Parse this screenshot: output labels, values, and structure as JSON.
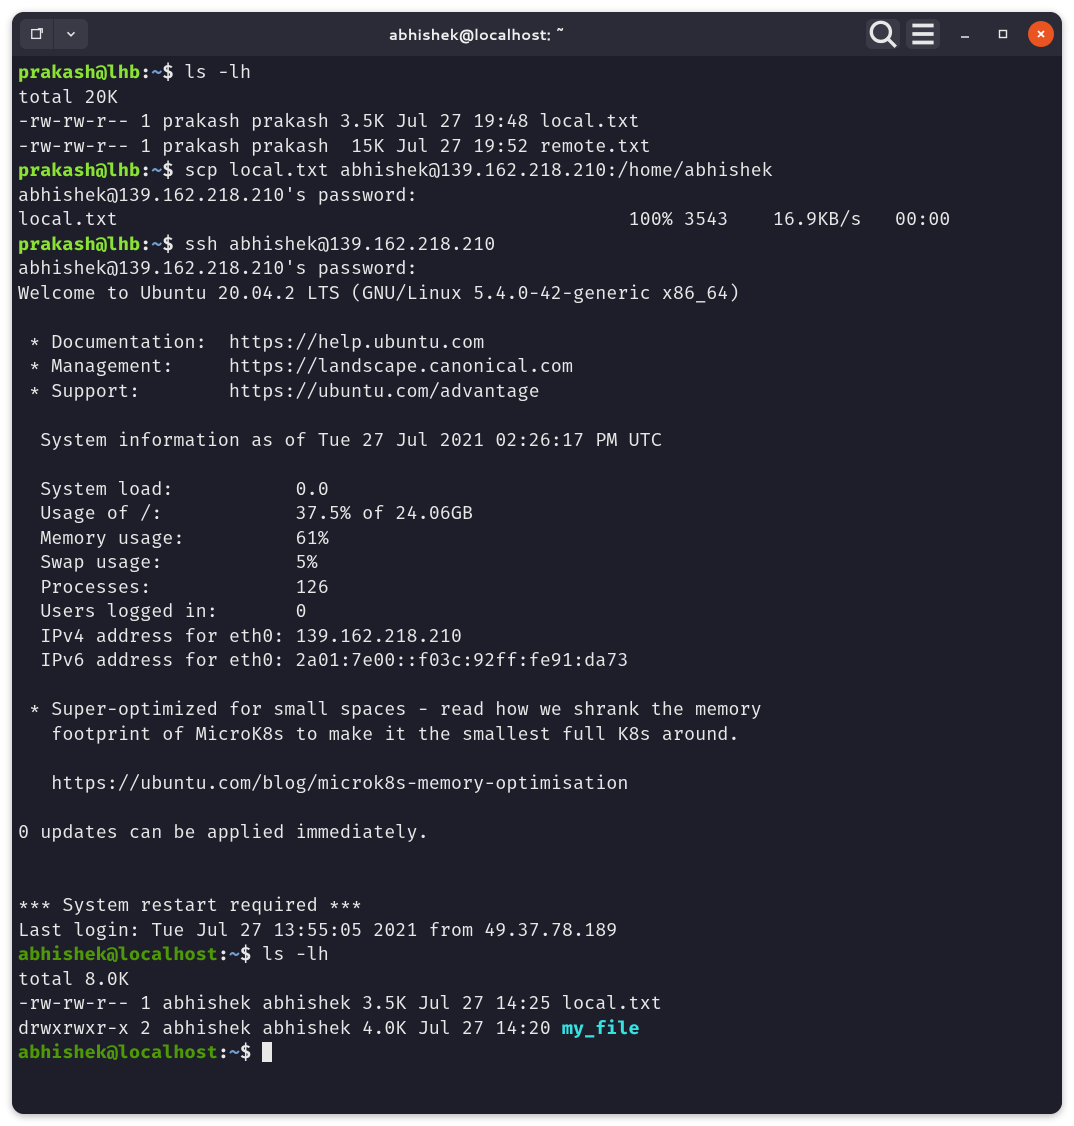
{
  "window": {
    "title": "abhishek@localhost: ~"
  },
  "prompts": {
    "p1": {
      "user": "prakash@lhb",
      "path": "~",
      "cmd": "ls -lh"
    },
    "p2": {
      "user": "prakash@lhb",
      "path": "~",
      "cmd": "scp local.txt abhishek@139.162.218.210:/home/abhishek"
    },
    "p3": {
      "user": "prakash@lhb",
      "path": "~",
      "cmd": "ssh abhishek@139.162.218.210"
    },
    "p4": {
      "user": "abhishek@localhost",
      "path": "~",
      "cmd": "ls -lh"
    },
    "p5": {
      "user": "abhishek@localhost",
      "path": "~",
      "cmd": ""
    }
  },
  "out": {
    "ls1_total": "total 20K",
    "ls1_l1": "-rw-rw-r-- 1 prakash prakash 3.5K Jul 27 19:48 local.txt",
    "ls1_l2": "-rw-rw-r-- 1 prakash prakash  15K Jul 27 19:52 remote.txt",
    "scp_pw": "abhishek@139.162.218.210's password: ",
    "scp_progress": "local.txt                                              100% 3543    16.9KB/s   00:00",
    "ssh_pw": "abhishek@139.162.218.210's password: ",
    "welcome": "Welcome to Ubuntu 20.04.2 LTS (GNU/Linux 5.4.0-42-generic x86_64)",
    "doc": " * Documentation:  https://help.ubuntu.com",
    "mgmt": " * Management:     https://landscape.canonical.com",
    "sup": " * Support:        https://ubuntu.com/advantage",
    "sysinfo_hdr": "  System information as of Tue 27 Jul 2021 02:26:17 PM UTC",
    "sys_load": "  System load:           0.0",
    "sys_usage": "  Usage of /:            37.5% of 24.06GB",
    "sys_mem": "  Memory usage:          61%",
    "sys_swap": "  Swap usage:            5%",
    "sys_proc": "  Processes:             126",
    "sys_users": "  Users logged in:       0",
    "sys_ipv4": "  IPv4 address for eth0: 139.162.218.210",
    "sys_ipv6": "  IPv6 address for eth0: 2a01:7e00::f03c:92ff:fe91:da73",
    "micro1": " * Super-optimized for small spaces - read how we shrank the memory",
    "micro2": "   footprint of MicroK8s to make it the smallest full K8s around.",
    "micro3": "   https://ubuntu.com/blog/microk8s-memory-optimisation",
    "updates": "0 updates can be applied immediately.",
    "restart": "*** System restart required ***",
    "lastlogin": "Last login: Tue Jul 27 13:55:05 2021 from 49.37.78.189",
    "ls2_total": "total 8.0K",
    "ls2_l1": "-rw-rw-r-- 1 abhishek abhishek 3.5K Jul 27 14:25 local.txt",
    "ls2_l2_pre": "drwxrwxr-x 2 abhishek abhishek 4.0K Jul 27 14:20 ",
    "ls2_l2_dir": "my_file"
  }
}
